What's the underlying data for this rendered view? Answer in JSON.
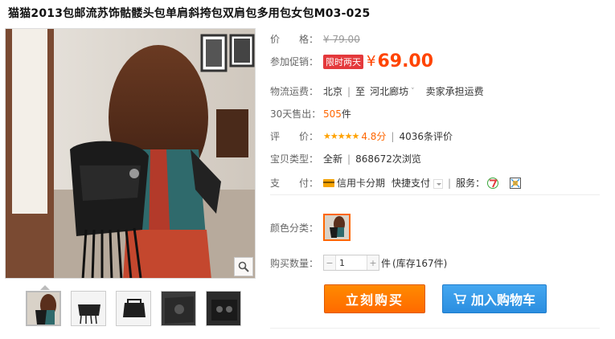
{
  "product": {
    "title": "猫猫2013包邮流苏饰骷髅头包单肩斜挎包双肩包多用包女包M03-025"
  },
  "price": {
    "label": "价　　格：",
    "currency": "¥",
    "original": "79.00"
  },
  "promo": {
    "label": "参加促销：",
    "tag": "限时两天",
    "currency": "¥",
    "price": "69.00"
  },
  "shipping": {
    "label": "物流运费：",
    "from": "北京",
    "to_word": "至",
    "to": "河北廊坊",
    "fee": "卖家承担运费"
  },
  "sales": {
    "label": "30天售出：",
    "count": "505",
    "unit": "件"
  },
  "rating": {
    "label": "评　　价：",
    "stars": "★★★★★",
    "score": "4.8分",
    "reviews": "4036条评价"
  },
  "item_type": {
    "label": "宝贝类型：",
    "condition": "全新",
    "views": "868672次浏览"
  },
  "payment": {
    "label": "支　　付：",
    "credit": "信用卡分期",
    "quickpay": "快捷支付",
    "service_label": "服务："
  },
  "color": {
    "label": "颜色分类："
  },
  "quantity": {
    "label": "购买数量：",
    "minus": "−",
    "plus": "+",
    "value": "1",
    "unit": "件",
    "stock": "(库存167件)"
  },
  "actions": {
    "buy_now": "立刻购买",
    "add_cart": "加入购物车"
  },
  "colors": {
    "accent": "#ff4400",
    "buy_button": "#ff7300",
    "cart_button": "#3a9ae8",
    "promo_tag": "#e4393c"
  }
}
